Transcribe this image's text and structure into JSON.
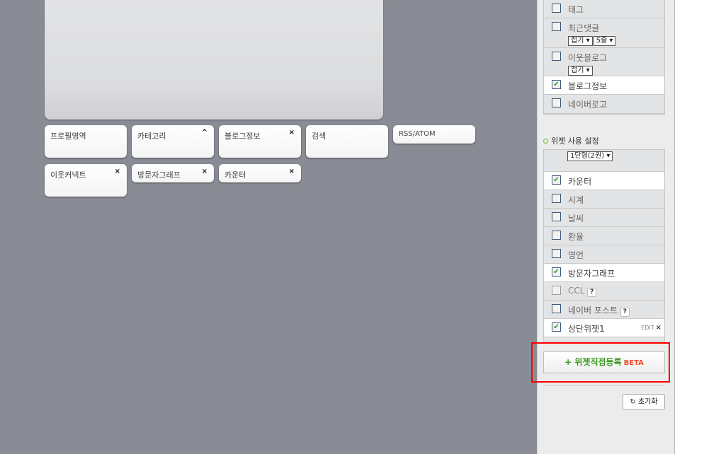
{
  "canvas": {
    "widgets": [
      {
        "label": "프로필영역",
        "control": ""
      },
      {
        "label": "카테고리",
        "control": "^"
      },
      {
        "label": "블로그정보",
        "control": "×"
      },
      {
        "label": "검색",
        "control": ""
      },
      {
        "label": "RSS/ATOM",
        "control": ""
      },
      {
        "label": "이웃커넥트",
        "control": "×"
      },
      {
        "label": "방문자그래프",
        "control": "×"
      },
      {
        "label": "카운터",
        "control": "×"
      }
    ]
  },
  "panel": {
    "list1": [
      {
        "label": "태그",
        "checked": false
      },
      {
        "label": "최근댓글",
        "checked": false,
        "selects": [
          "접기",
          "5줄"
        ]
      },
      {
        "label": "이웃블로그",
        "checked": false,
        "selects": [
          "접기"
        ]
      },
      {
        "label": "블로그정보",
        "checked": true
      },
      {
        "label": "네이버로고",
        "checked": false
      }
    ],
    "widget_header": "위젯 사용 설정",
    "layout_select": "1단형(2권)",
    "list2": [
      {
        "label": "카운터",
        "checked": true
      },
      {
        "label": "시계",
        "checked": false
      },
      {
        "label": "날씨",
        "checked": false
      },
      {
        "label": "환율",
        "checked": false
      },
      {
        "label": "명언",
        "checked": false
      },
      {
        "label": "방문자그래프",
        "checked": true
      },
      {
        "label": "CCL",
        "checked": false,
        "disabled": true,
        "help": "?"
      },
      {
        "label": "네이버 포스트",
        "checked": false,
        "help": "?"
      },
      {
        "label": "상단위젯1",
        "checked": true,
        "edit": "EDIT",
        "remove": "×"
      }
    ],
    "add_button": {
      "plus": "+",
      "label": "위젯직접등록",
      "badge": "BETA"
    },
    "reset_button": {
      "icon": "↻",
      "label": "초기화"
    },
    "checkmark": "✔"
  }
}
